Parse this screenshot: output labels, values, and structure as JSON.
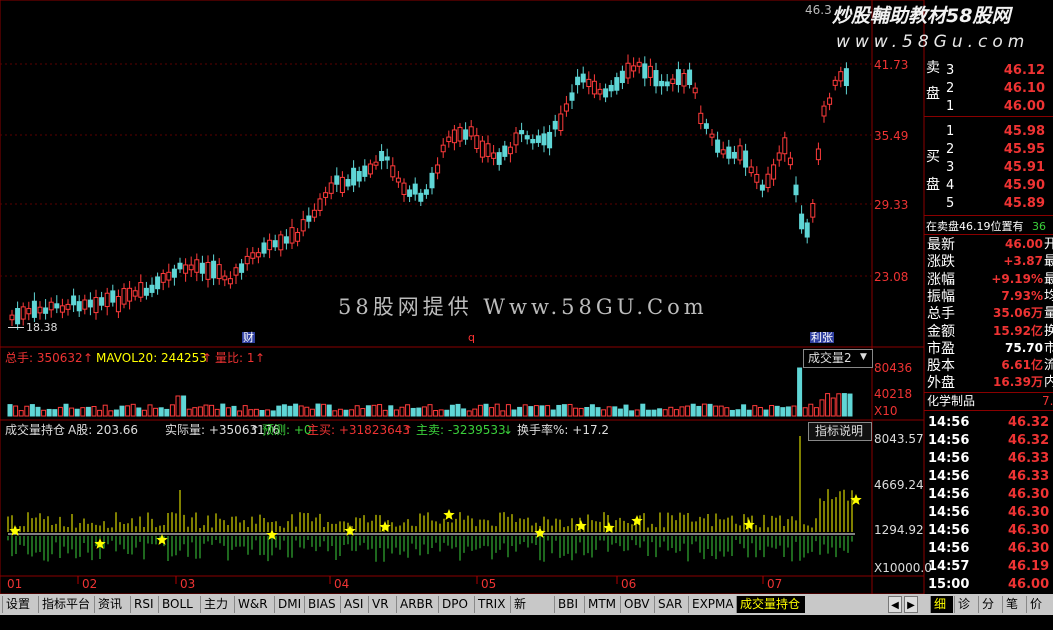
{
  "watermark": {
    "top_brand": "炒股輔助教材58股网",
    "top_url": "www.58Gu.com",
    "center": "58股网提供 Www.58GU.Com",
    "top_price_partial": "46.3"
  },
  "price_axis": [
    "41.73",
    "35.49",
    "29.33",
    "23.08"
  ],
  "price_low_label": "18.38",
  "event_markers": {
    "cai": "财",
    "q": "q",
    "li": "利张"
  },
  "volume_header": {
    "total_label": "总手: 350632",
    "mavol_label": "MAVOL20: 244253",
    "ratio_label": "量比: 1",
    "selector": "成交量2",
    "axis": [
      "80436",
      "40218",
      "X10"
    ]
  },
  "indicator_header": {
    "name": "成交量持仓",
    "a_label": "A股: 203.66",
    "actual_label": "实际量: +35063176",
    "forecast_label": "预测: +0",
    "main_buy_label": "主买: +31823643",
    "main_sell_label": "主卖: -3239533",
    "turnover_label": "换手率%: +17.2",
    "help_button": "指标说明",
    "axis": [
      "8043.57",
      "4669.24",
      "1294.92",
      "X10000.0"
    ]
  },
  "date_axis": [
    "01",
    "02",
    "03",
    "04",
    "05",
    "06",
    "07"
  ],
  "order_book": {
    "sell_group_label": "卖盘",
    "buy_group_label": "买盘",
    "sell": [
      {
        "level": "3",
        "price": "46.12"
      },
      {
        "level": "2",
        "price": "46.10"
      },
      {
        "level": "1",
        "price": "46.00"
      }
    ],
    "buy": [
      {
        "level": "1",
        "price": "45.98"
      },
      {
        "level": "2",
        "price": "45.95"
      },
      {
        "level": "3",
        "price": "45.91"
      },
      {
        "level": "4",
        "price": "45.90"
      },
      {
        "level": "5",
        "price": "45.89"
      }
    ],
    "pending_label": "在卖盘46.19位置有",
    "pending_value": "36"
  },
  "stats": [
    {
      "label": "最新",
      "value": "46.00",
      "suffix": "开"
    },
    {
      "label": "涨跌",
      "value": "+3.87",
      "suffix": "最"
    },
    {
      "label": "涨幅",
      "value": "+9.19%",
      "suffix": "最"
    },
    {
      "label": "振幅",
      "value": "7.93%",
      "suffix": "均"
    },
    {
      "label": "总手",
      "value": "35.06万",
      "suffix": "量"
    },
    {
      "label": "金额",
      "value": "15.92亿",
      "suffix": "换"
    },
    {
      "label": "市盈",
      "value": "75.70",
      "suffix": "市"
    },
    {
      "label": "股本",
      "value": "6.61亿",
      "suffix": "流"
    },
    {
      "label": "外盘",
      "value": "16.39万",
      "suffix": "内"
    }
  ],
  "sector": {
    "name": "化学制品",
    "value": "7."
  },
  "ticks": [
    {
      "time": "14:56",
      "price": "46.32"
    },
    {
      "time": "14:56",
      "price": "46.32"
    },
    {
      "time": "14:56",
      "price": "46.33"
    },
    {
      "time": "14:56",
      "price": "46.33"
    },
    {
      "time": "14:56",
      "price": "46.30"
    },
    {
      "time": "14:56",
      "price": "46.30"
    },
    {
      "time": "14:56",
      "price": "46.30"
    },
    {
      "time": "14:56",
      "price": "46.30"
    },
    {
      "time": "14:57",
      "price": "46.19"
    },
    {
      "time": "15:00",
      "price": "46.00"
    }
  ],
  "tabs": [
    "设置",
    "指标平台",
    "资讯",
    "RSI",
    "BOLL",
    "主力",
    "W&R",
    "DMI",
    "BIAS",
    "ASI",
    "VR",
    "ARBR",
    "DPO",
    "TRIX",
    "新DMA",
    "BBI",
    "MTM",
    "OBV",
    "SAR",
    "EXPMA",
    "成交量持仓"
  ],
  "right_tabs": [
    "细",
    "诊",
    "分",
    "笔",
    "价"
  ],
  "colors": {
    "up": "#ff3b3b",
    "down": "#5fd6d6",
    "axis_red": "#b00000",
    "yellow": "#ffff00",
    "green": "#3bd13b"
  }
}
